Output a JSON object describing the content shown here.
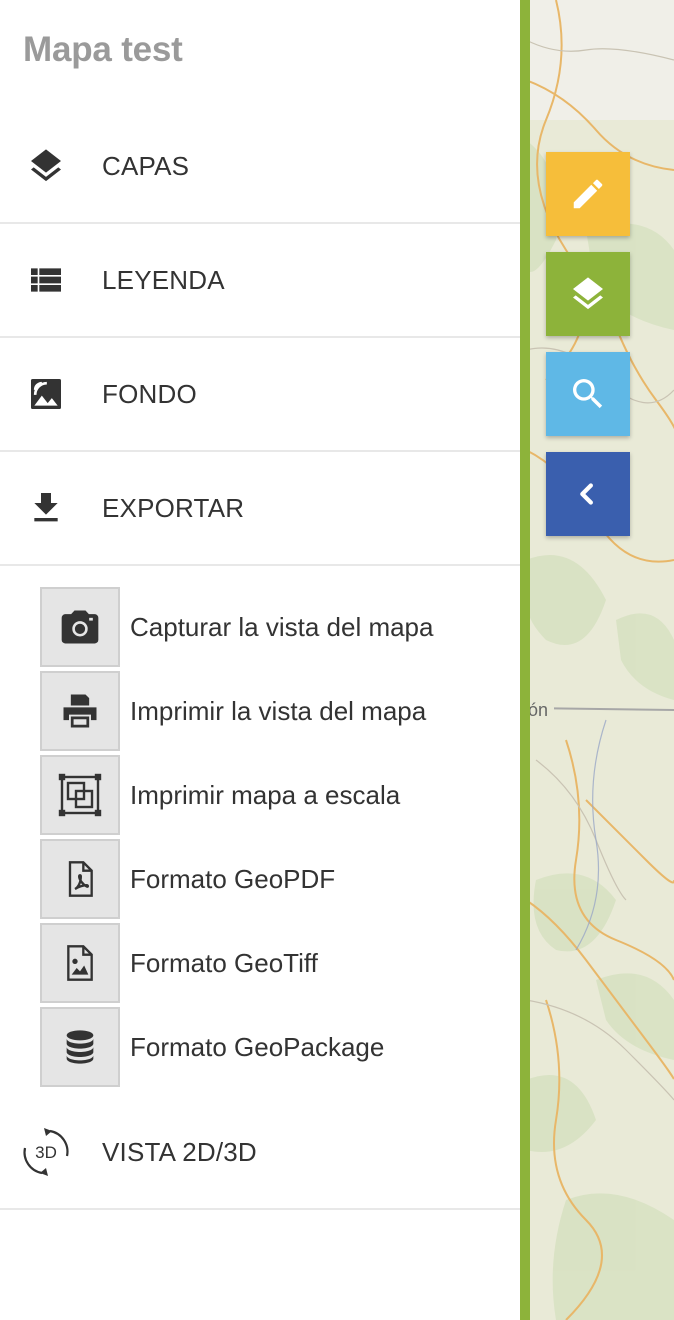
{
  "app": {
    "title": "Mapa test"
  },
  "menu": [
    {
      "key": "capas",
      "label": "CAPAS",
      "icon": "layers-icon"
    },
    {
      "key": "leyenda",
      "label": "LEYENDA",
      "icon": "list-icon"
    },
    {
      "key": "fondo",
      "label": "FONDO",
      "icon": "image-icon"
    },
    {
      "key": "exportar",
      "label": "EXPORTAR",
      "icon": "download-icon"
    },
    {
      "key": "vista",
      "label": "VISTA 2D/3D",
      "icon": "rotate-3d-icon",
      "icon_text": "3D"
    }
  ],
  "export_options": [
    {
      "label": "Capturar la vista del mapa",
      "icon": "camera-icon"
    },
    {
      "label": "Imprimir la vista del mapa",
      "icon": "printer-icon"
    },
    {
      "label": "Imprimir mapa a escala",
      "icon": "scale-frame-icon"
    },
    {
      "label": "Formato GeoPDF",
      "icon": "pdf-file-icon"
    },
    {
      "label": "Formato GeoTiff",
      "icon": "image-file-icon"
    },
    {
      "label": "Formato GeoPackage",
      "icon": "database-icon"
    }
  ],
  "map": {
    "partial_label": "ón"
  },
  "toolbar": [
    {
      "name": "edit-button",
      "icon": "pencil-icon",
      "color": "#f6be3a"
    },
    {
      "name": "layers-button",
      "icon": "layers-icon",
      "color": "#8db33a"
    },
    {
      "name": "search-button",
      "icon": "search-icon",
      "color": "#5fb8e6"
    },
    {
      "name": "collapse-button",
      "icon": "chevron-left-icon",
      "color": "#3a5fae"
    }
  ],
  "colors": {
    "accent_green": "#8db33a",
    "title_gray": "#9a9a9a"
  }
}
